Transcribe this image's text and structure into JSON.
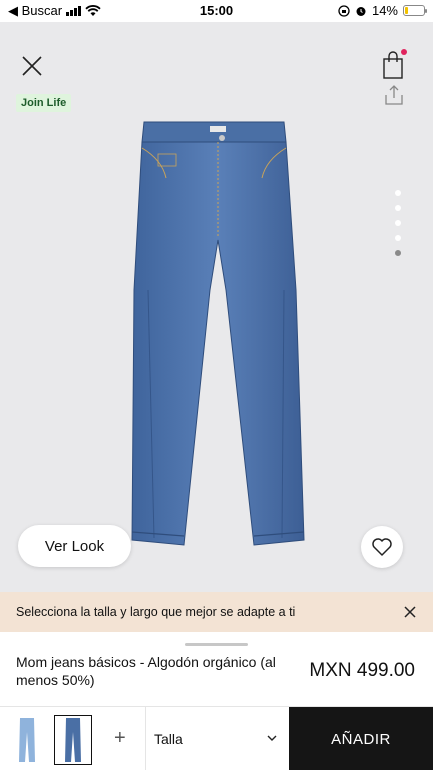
{
  "status_bar": {
    "back_app": "◀ Buscar",
    "time": "15:00",
    "battery_text": "14%",
    "battery_level": 0.14
  },
  "product": {
    "badge": "Join Life",
    "view_look_label": "Ver Look",
    "name": "Mom jeans básicos - Algodón orgánico (al menos 50%)",
    "price": "MXN 499.00",
    "image_count": 5,
    "active_image": 5
  },
  "size_banner": {
    "text": "Selecciona la talla y largo que mejor se adapte a ti"
  },
  "bottom_bar": {
    "add_symbol": "+",
    "size_label": "Talla",
    "add_button": "AÑADIR"
  },
  "colors": {
    "accent_dark": "#151515",
    "banner_bg": "#f3e3d4",
    "badge_bg": "#dff4dd",
    "denim": "#4a6fa5"
  },
  "icons": [
    "close-icon",
    "bag-icon",
    "share-icon",
    "heart-icon",
    "chevron-down-icon",
    "wifi-icon",
    "alarm-icon"
  ]
}
